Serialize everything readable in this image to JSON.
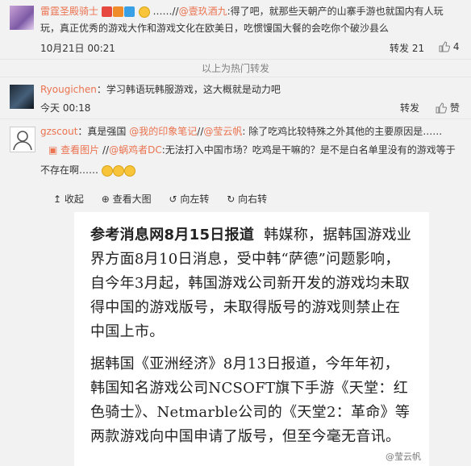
{
  "comments": [
    {
      "user": "雷霆圣殿骑士",
      "text_pre": "……//",
      "mention": "@壹玖酒九",
      "text_after": ":得了吧，就那些天朝产的山寨手游也就国内有人玩",
      "line2": "玩，真正优秀的游戏大作和游戏文化在欧美日，吃惯馒国大餐的会吃你个破沙县么",
      "time": "10月21日 00:21",
      "repost": "转发 21",
      "likes": "4"
    },
    {
      "user": "Ryougichen",
      "text": "：学习韩语玩韩服游戏，这大概就是动力吧",
      "time": "今天 00:18",
      "repost": "转发",
      "likes": "赞"
    },
    {
      "user": "gzscout",
      "text": "：真是强国",
      "mention1": "@我的印象笔记",
      "sep1": "//",
      "mention2": "@莹云帆",
      "text2": ": 除了吃鸡比较特殊之外其他的主要原因是……",
      "view_image": "查看图片",
      "sep2": "//",
      "mention3": "@蜗鸡者DC",
      "text3": ":无法打入中国市场？吃鸡是干嘛的？是不是白名单里没有的游戏等于",
      "line3": "不存在啊……"
    }
  ],
  "hot_divider": "以上为热门转发",
  "toolbar": {
    "collapse": "收起",
    "view_large": "查看大图",
    "rotate_left": "向左转",
    "rotate_right": "向右转"
  },
  "article": {
    "lead": "参考消息网8月15日报道",
    "p1": "韩媒称，据韩国游戏业界方面8月10日消息，受中韩“萨德”问题影响，自今年3月起，韩国游戏公司新开发的游戏均未取得中国的游戏版号，未取得版号的游戏则禁止在中国上市。",
    "p2": "据韩国《亚洲经济》8月13日报道，今年年初，韩国知名游戏公司NCSOFT旗下手游《天堂：红色骑士》、Netmarble公司的《天堂2：革命》等两款游戏向中国申请了版号，但至今毫无音讯。",
    "watermark": "@莹云帆"
  },
  "colors": {
    "link": "#eb7350",
    "background": "#f2f2f2",
    "divider": "#e6e6e6"
  }
}
